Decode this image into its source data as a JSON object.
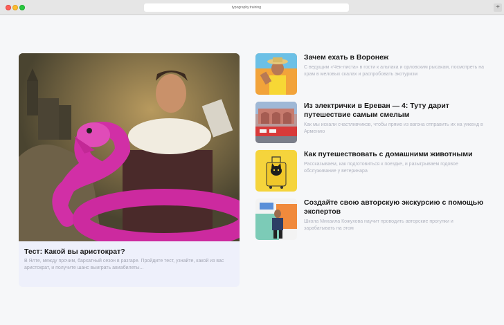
{
  "browser": {
    "url": "typography.training",
    "new_tab_icon": "plus"
  },
  "feature": {
    "title": "Тест: Какой вы аристократ?",
    "description": "В Ялте, между прочим, бархатный сезон в разгаре. Пройдите тест, узнайте, какой из вас аристократ, и получите шанс выиграть авиабилеты..."
  },
  "articles": [
    {
      "title": "Зачем ехать в Воронеж",
      "description": "С ведущим «Чек-листа» в гости к альпака и орловским рысакам, посмотреть на храм в меловых скалах и распробовать экотуризм"
    },
    {
      "title": "Из электрички в Ереван — 4: Туту дарит путешествие самым смелым",
      "description": "Как мы искали счастливчиков, чтобы прямо из вагона отправить их на уикенд в Армению"
    },
    {
      "title": "Как путешествовать с домашними животными",
      "description": "Рассказываем, как подготовиться к поездке, и разыгрываем годовое обслуживание у ветеринара"
    },
    {
      "title": "Создайте свою авторскую экскурсию с помощью экспертов",
      "description": "Школа Михаила Кожухова научит проводить авторские прогулки и зарабатывать на этом"
    }
  ]
}
